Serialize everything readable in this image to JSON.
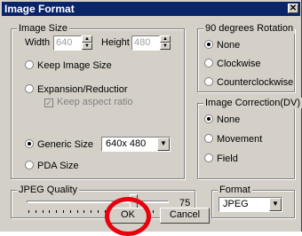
{
  "window": {
    "title": "Image Format",
    "close_glyph": "✕"
  },
  "image_size": {
    "legend": "Image Size",
    "width_label": "Width",
    "width_value": "640",
    "height_label": "Height",
    "height_value": "480",
    "keep_image_size": "Keep Image Size",
    "expansion_reductior": "Expansion/Reductior",
    "keep_aspect_ratio": "Keep aspect ratio",
    "generic_size": "Generic Size",
    "generic_size_value": "640x 480",
    "pda_size": "PDA Size",
    "selected": "Generic Size"
  },
  "rotation": {
    "legend": "90 degrees Rotation",
    "options": [
      "None",
      "Clockwise",
      "Counterclockwise"
    ],
    "selected": "None"
  },
  "image_correction": {
    "legend": "Image Correction(DV)",
    "options": [
      "None",
      "Movement",
      "Field"
    ],
    "selected": "None"
  },
  "jpeg_quality": {
    "legend": "JPEG Quality",
    "value": "75",
    "level": 0.75
  },
  "format": {
    "legend": "Format",
    "value": "JPEG"
  },
  "buttons": {
    "ok": "OK",
    "cancel": "Cancel"
  },
  "colors": {
    "title_bar": "#0a246a",
    "face": "#d4d0c8",
    "highlight_ring": "#e8000e"
  },
  "icons": {
    "close": "close-icon",
    "dropdown": "chevron-down-icon",
    "spin_up": "spin-up-icon",
    "spin_down": "spin-down-icon"
  }
}
